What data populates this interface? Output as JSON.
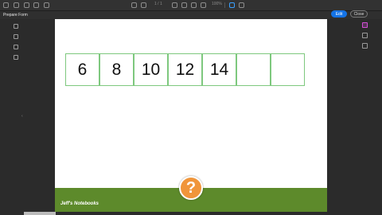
{
  "toolbar": {
    "page_indicator": "1 / 1",
    "zoom": "100%",
    "edit_label": "Edit",
    "close_label": "Close"
  },
  "subbar": {
    "tool_name": "Prepare Form"
  },
  "sequence": {
    "values": [
      "6",
      "8",
      "10",
      "12",
      "14",
      "",
      ""
    ]
  },
  "footer": {
    "brand": "Jeff's Notebooks",
    "help_symbol": "?",
    "bar_color": "#5d8a2b",
    "help_color": "#f0953a"
  }
}
